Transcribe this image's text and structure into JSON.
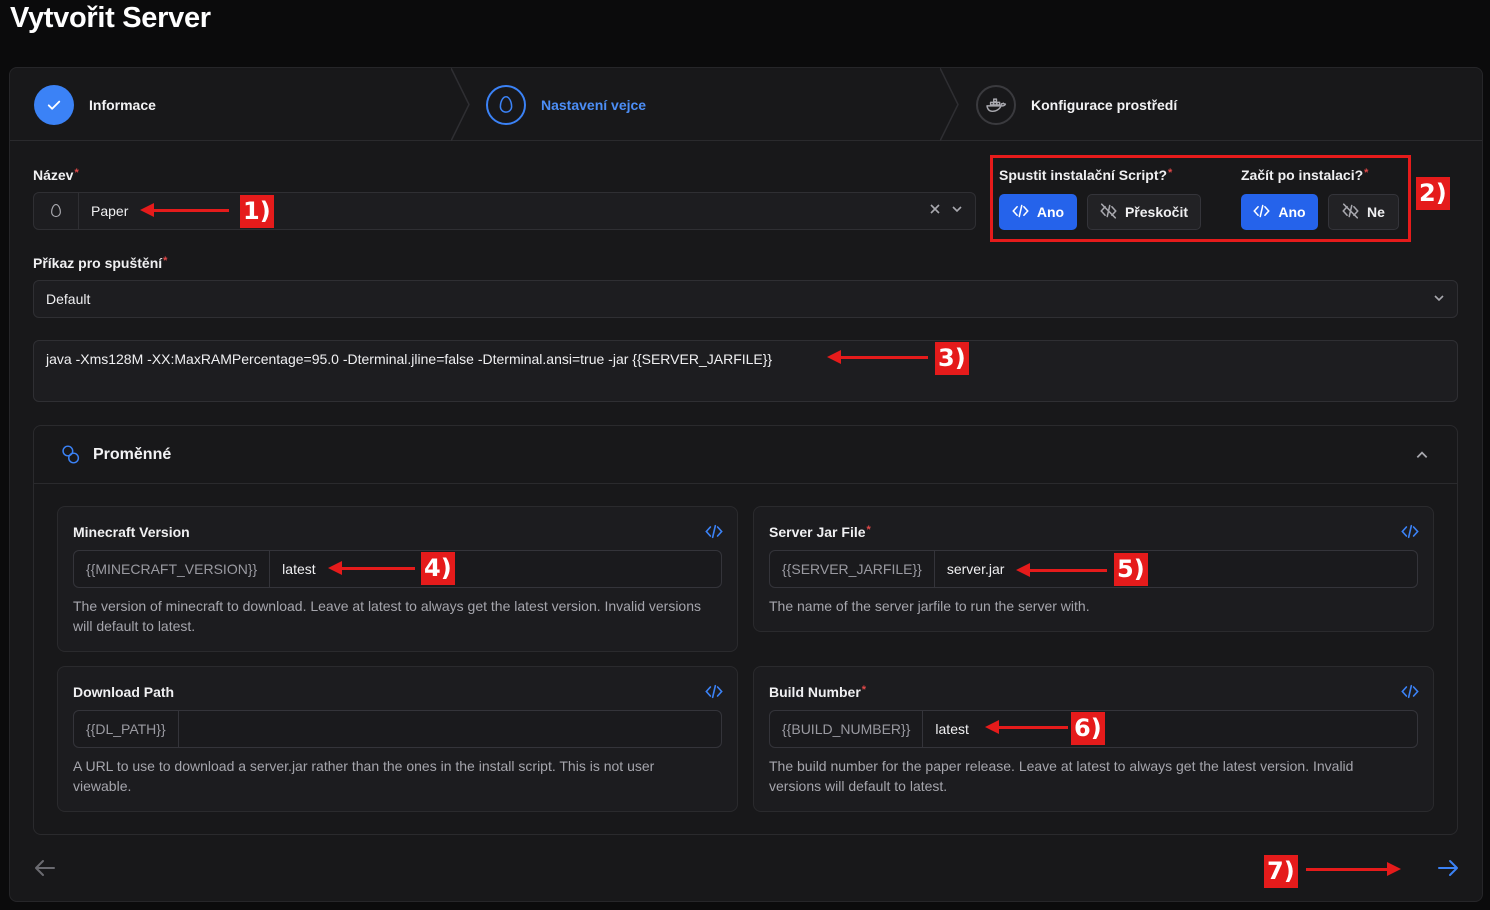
{
  "page": {
    "title": "Vytvořit Server"
  },
  "stepper": {
    "steps": [
      {
        "label": "Informace",
        "state": "done"
      },
      {
        "label": "Nastavení vejce",
        "state": "active"
      },
      {
        "label": "Konfigurace prostředí",
        "state": "pending"
      }
    ]
  },
  "form": {
    "name": {
      "label": "Název",
      "required_mark": "*",
      "value": "Paper"
    },
    "install_script": {
      "label": "Spustit instalační Script?",
      "required_mark": "*",
      "yes_label": "Ano",
      "skip_label": "Přeskočit"
    },
    "start_after": {
      "label": "Začít po instalaci?",
      "required_mark": "*",
      "yes_label": "Ano",
      "no_label": "Ne"
    },
    "startup": {
      "label": "Příkaz pro spuštění",
      "required_mark": "*",
      "selected": "Default",
      "command": "java -Xms128M -XX:MaxRAMPercentage=95.0 -Dterminal.jline=false -Dterminal.ansi=true -jar {{SERVER_JARFILE}}"
    }
  },
  "variables": {
    "title": "Proměnné",
    "items": [
      {
        "name": "Minecraft Version",
        "required": false,
        "env": "{{MINECRAFT_VERSION}}",
        "value": "latest",
        "description": "The version of minecraft to download. Leave at latest to always get the latest version. Invalid versions will default to latest."
      },
      {
        "name": "Server Jar File",
        "required": true,
        "required_mark": "*",
        "env": "{{SERVER_JARFILE}}",
        "value": "server.jar",
        "description": "The name of the server jarfile to run the server with."
      },
      {
        "name": "Download Path",
        "required": false,
        "env": "{{DL_PATH}}",
        "value": "",
        "description": "A URL to use to download a server.jar rather than the ones in the install script. This is not user viewable."
      },
      {
        "name": "Build Number",
        "required": true,
        "required_mark": "*",
        "env": "{{BUILD_NUMBER}}",
        "value": "latest",
        "description": "The build number for the paper release. Leave at latest to always get the latest version. Invalid versions will default to latest."
      }
    ]
  },
  "annotations": [
    "1)",
    "2)",
    "3)",
    "4)",
    "5)",
    "6)",
    "7)"
  ],
  "colors": {
    "accent": "#3b82f6",
    "primary_button": "#2563eb",
    "annotation": "#e51b1b",
    "required": "#e04848"
  },
  "icons": [
    "check-icon",
    "egg-icon",
    "docker-icon",
    "code-icon",
    "code-off-icon",
    "close-icon",
    "chevron-down-icon",
    "chevron-up-icon",
    "variables-icon",
    "arrow-left-icon",
    "arrow-right-icon"
  ]
}
